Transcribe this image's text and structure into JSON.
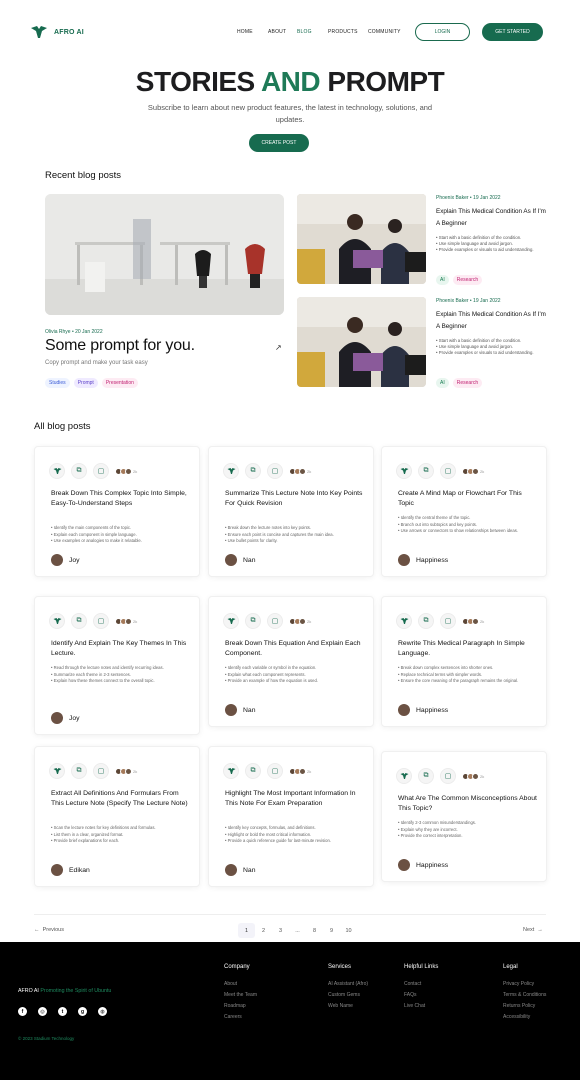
{
  "brand": {
    "name": "AFRO AI",
    "tagline_lead": "AFRO AI",
    "tagline_rest": "Promoting the Spirit of Ubuntu"
  },
  "nav": {
    "links": [
      "HOME",
      "ABOUT",
      "BLOG",
      "PRODUCTS",
      "COMMUNITY"
    ],
    "active": "BLOG",
    "login": "LOGIN",
    "get_started": "GET STARTED"
  },
  "hero": {
    "title_part1": "STORIES",
    "title_part2": "AND",
    "title_part3": "PROMPT",
    "subtitle": "Subscribe to learn about new product features, the latest in technology, solutions, and updates.",
    "cta": "CREATE POST"
  },
  "recent": {
    "heading": "Recent blog posts",
    "featured": {
      "meta": "Olivia Rhye • 20 Jan 2022",
      "title": "Some prompt for you.",
      "description": "Copy prompt and make your task easy",
      "tags": [
        "Studies",
        "Prompt",
        "Presentation"
      ]
    },
    "side": [
      {
        "meta": "Phoenix Baker • 19 Jan 2022",
        "title": "Explain This Medical Condition As If I'm A Beginner",
        "bullets": [
          "Start with a basic definition of the condition.",
          "Use simple language and avoid jargon.",
          "Provide examples or visuals to aid understanding."
        ],
        "tags": [
          "AI",
          "Research"
        ]
      },
      {
        "meta": "Phoenix Baker • 19 Jan 2022",
        "title": "Explain This Medical Condition As If I'm A Beginner",
        "bullets": [
          "Start with a basic definition of the condition.",
          "Use simple language and avoid jargon.",
          "Provide examples or visuals to aid understanding."
        ],
        "tags": [
          "AI",
          "Research"
        ]
      }
    ]
  },
  "all": {
    "heading": "All blog posts",
    "avatar_more": "2k",
    "cards": [
      {
        "title": "Break Down This Complex Topic Into Simple, Easy-To-Understand Steps",
        "bullets": [
          "Identify the main components of the topic.",
          "Explain each component in simple language.",
          "Use examples or analogies to make it relatable."
        ],
        "author": "Joy"
      },
      {
        "title": "Summarize This Lecture Note Into Key Points For Quick Revision",
        "bullets": [
          "Break down the lecture notes into key points.",
          "Ensure each point is concise and captures the main idea.",
          "Use bullet points for clarity."
        ],
        "author": "Nan"
      },
      {
        "title": "Create A Mind Map or Flowchart For This Topic",
        "bullets": [
          "Identify the central theme of the topic.",
          "Branch out into subtopics and key points.",
          "Use arrows or connectors to show relationships between ideas."
        ],
        "author": "Happiness"
      },
      {
        "title": "Identify And Explain The Key Themes In This Lecture.",
        "bullets": [
          "Read through the lecture notes and identify recurring ideas.",
          "Summarize each theme in 2-3 sentences.",
          "Explain how these themes connect to the overall topic."
        ],
        "author": "Joy"
      },
      {
        "title": "Break Down This Equation And Explain Each Component.",
        "bullets": [
          "Identify each variable or symbol in the equation.",
          "Explain what each component represents.",
          "Provide an example of how the equation is used."
        ],
        "author": "Nan"
      },
      {
        "title": "Rewrite This Medical Paragraph In Simple Language.",
        "bullets": [
          "Break down complex sentences into shorter ones.",
          "Replace technical terms with simpler words.",
          "Ensure the core meaning of the paragraph remains the original."
        ],
        "author": "Happiness"
      },
      {
        "title": "Extract All Definitions And Formulars From This Lecture Note (Specify The Lecture Note)",
        "bullets": [
          "Scan the lecture notes for key definitions and formulas.",
          "List them in a clear, organized format.",
          "Provide brief explanations for each."
        ],
        "author": "Edikan"
      },
      {
        "title": "Highlight The Most Important Information In This Note For Exam Preparation",
        "bullets": [
          "Identify key concepts, formulas, and definitions.",
          "Highlight or bold the most critical information.",
          "Provide a quick reference guide for last-minute revision."
        ],
        "author": "Nan"
      },
      {
        "title": "What Are The Common Misconceptions About This Topic?",
        "bullets": [
          "Identify 2-3 common misunderstandings.",
          "Explain why they are incorrect.",
          "Provide the correct interpretation."
        ],
        "author": "Happiness"
      }
    ]
  },
  "pagination": {
    "previous": "Previous",
    "next": "Next",
    "pages": [
      "1",
      "2",
      "3",
      "...",
      "8",
      "9",
      "10"
    ],
    "current": "1"
  },
  "footer": {
    "copyright": "© 2023 Stadium Technology",
    "columns": [
      {
        "heading": "Company",
        "links": [
          "About",
          "Meet the Team",
          "Roadmap",
          "Careers"
        ]
      },
      {
        "heading": "Services",
        "links": [
          "AI Assistant (Afro)",
          "Custom Gems",
          "Web Name"
        ]
      },
      {
        "heading": "Helpful Links",
        "links": [
          "Contact",
          "FAQs",
          "Live Chat"
        ]
      },
      {
        "heading": "Legal",
        "links": [
          "Privacy Policy",
          "Terms & Conditions",
          "Returns Policy",
          "Accessibility"
        ]
      }
    ],
    "social_icons": [
      "facebook-icon",
      "instagram-icon",
      "twitter-icon",
      "github-icon",
      "dribbble-icon"
    ]
  },
  "colors": {
    "brand_green": "#176b4f",
    "accent_green": "#1e7a57",
    "footer_bg": "#000000"
  }
}
